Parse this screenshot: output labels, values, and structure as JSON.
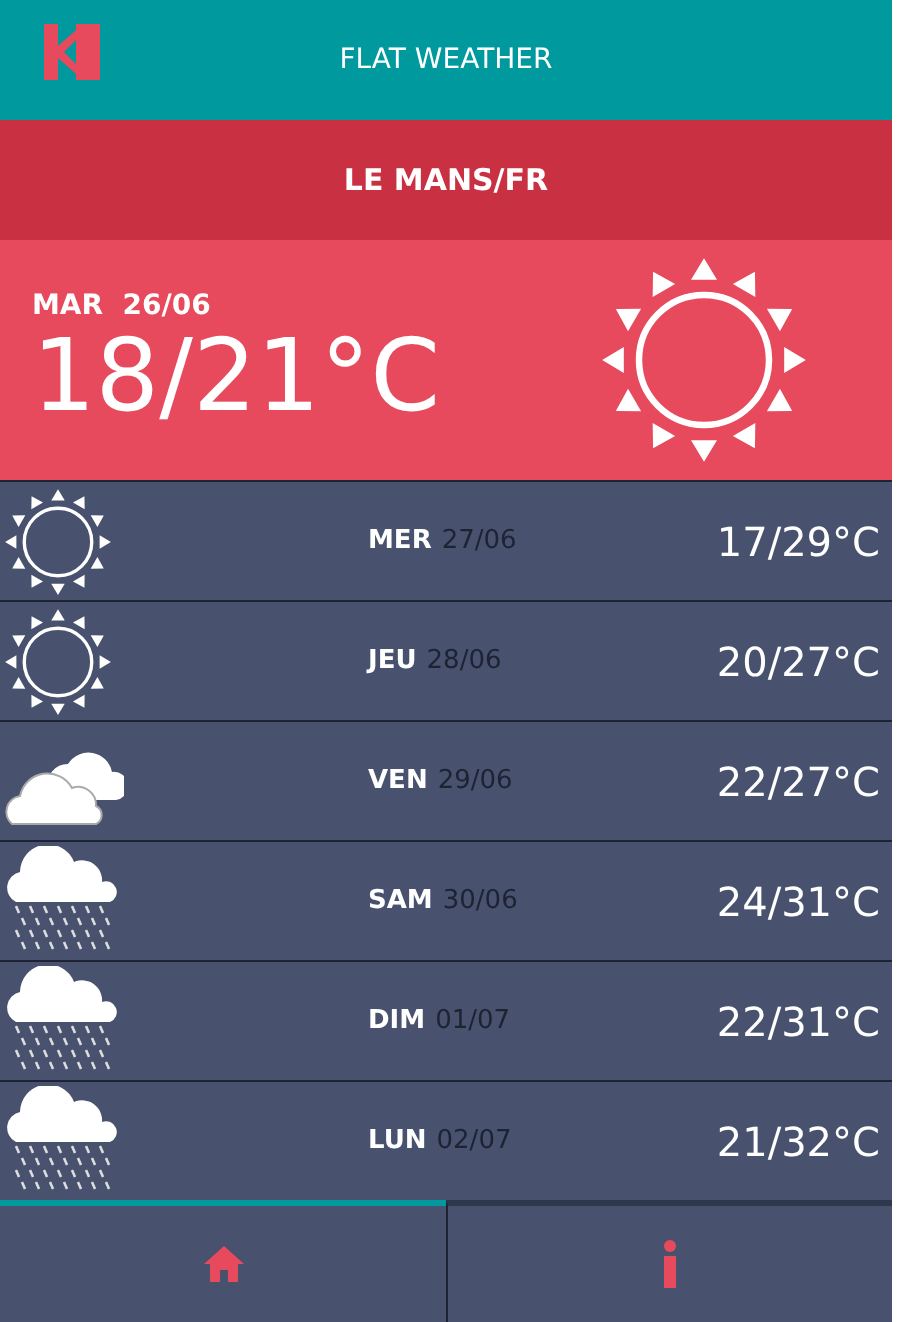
{
  "header": {
    "title": "FLAT WEATHER"
  },
  "city": "LE MANS/FR",
  "today": {
    "day": "MAR",
    "date": "26/06",
    "temp": "18/21°C",
    "kind": "sunny"
  },
  "forecast": [
    {
      "day": "MER",
      "date": "27/06",
      "temp": "17/29°C",
      "kind": "sunny"
    },
    {
      "day": "JEU",
      "date": "28/06",
      "temp": "20/27°C",
      "kind": "sunny"
    },
    {
      "day": "VEN",
      "date": "29/06",
      "temp": "22/27°C",
      "kind": "cloudy"
    },
    {
      "day": "SAM",
      "date": "30/06",
      "temp": "24/31°C",
      "kind": "rain"
    },
    {
      "day": "DIM",
      "date": "01/07",
      "temp": "22/31°C",
      "kind": "rain"
    },
    {
      "day": "LUN",
      "date": "02/07",
      "temp": "21/32°C",
      "kind": "rain"
    }
  ],
  "tabs": [
    {
      "kind": "home",
      "selected": true
    },
    {
      "kind": "info",
      "selected": false
    }
  ]
}
